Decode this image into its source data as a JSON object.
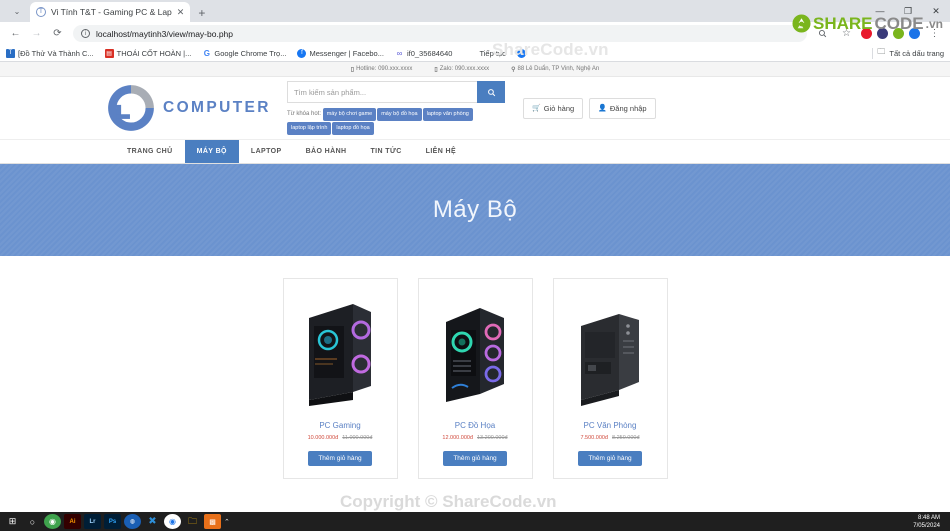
{
  "browser": {
    "tab": {
      "title": "Vi Tính T&T - Gaming PC & Lap",
      "favicon": "site-favicon",
      "close": "✕"
    },
    "new_tab": "+",
    "window_controls": {
      "minimize": "—",
      "maximize": "❐",
      "close": "✕"
    },
    "nav": {
      "back": "←",
      "forward": "→",
      "reload": "⟳"
    },
    "omnibox": {
      "url": "localhost/maytinh3/view/may-bo.php",
      "info_icon": "ⓘ",
      "zoom_icon": "🔍",
      "bookmark_icon": "☆"
    },
    "bookmarks": [
      {
        "label": "[Đồ Thử Và Thành C...",
        "color": "#2a6ec4",
        "glyph": "T"
      },
      {
        "label": "THOÁI CỐT HOÀN |...",
        "color": "#d93025",
        "glyph": "🗎"
      },
      {
        "label": "Google Chrome Trọ...",
        "color": "#ffffff",
        "glyph": "G"
      },
      {
        "label": "Messenger | Facebo...",
        "color": "#1877f2",
        "glyph": "f"
      },
      {
        "label": "if0_35684640",
        "color": "#ffffff",
        "glyph": "∞"
      },
      {
        "label": "Tiếp tục",
        "color": "#ffffff",
        "glyph": ""
      }
    ],
    "bookmarks_right": {
      "label": "Tất cả dấu trang",
      "icon": "folder-icon"
    }
  },
  "site": {
    "topbar": [
      {
        "icon": "phone-icon",
        "text": "Hotline: 090.xxx.xxxx"
      },
      {
        "icon": "phone-icon",
        "text": "Zalo: 090.xxx.xxxx"
      },
      {
        "icon": "location-icon",
        "text": "88 Lê Duẩn, TP Vinh, Nghệ An"
      }
    ],
    "logo": {
      "text": "COMPUTER",
      "mark": "tt-logo-mark"
    },
    "search": {
      "placeholder": "Tìm kiếm sản phẩm...",
      "value": "",
      "button_icon": "search-icon"
    },
    "keywords": {
      "label": "Từ khóa hot:",
      "tags": [
        "máy bộ chơi game",
        "máy bộ đồ họa",
        "laptop văn phòng",
        "laptop lập trình",
        "laptop đồ họa"
      ]
    },
    "header_buttons": [
      {
        "label": "Giỏ hàng",
        "icon": "cart-icon"
      },
      {
        "label": "Đăng nhập",
        "icon": "user-icon"
      }
    ],
    "nav": [
      {
        "label": "TRANG CHỦ",
        "active": false
      },
      {
        "label": "MÁY BỘ",
        "active": true
      },
      {
        "label": "LAPTOP",
        "active": false
      },
      {
        "label": "BẢO HÀNH",
        "active": false
      },
      {
        "label": "TIN TỨC",
        "active": false
      },
      {
        "label": "LIÊN HỆ",
        "active": false
      }
    ],
    "banner": {
      "title": "Máy Bộ"
    },
    "products": [
      {
        "name": "PC Gaming",
        "price_new": "10.000.000đ",
        "price_old": "11.000.000đ",
        "button": "Thêm giỏ hàng",
        "image": "pc-case-gaming-rgb"
      },
      {
        "name": "PC Đồ Họa",
        "price_new": "12.000.000đ",
        "price_old": "13.200.000đ",
        "button": "Thêm giỏ hàng",
        "image": "pc-case-graphics-rgb"
      },
      {
        "name": "PC Văn Phòng",
        "price_new": "7.500.000đ",
        "price_old": "8.250.000đ",
        "button": "Thêm giỏ hàng",
        "image": "pc-case-office"
      }
    ]
  },
  "watermarks": {
    "top_text": "ShareCode.vn",
    "bottom_text": "Copyright © ShareCode.vn",
    "logo": {
      "share": "SHARE",
      "code": "CODE",
      "vn": ".vn"
    }
  },
  "taskbar": {
    "icons": [
      {
        "name": "start-icon",
        "glyph": "⊞",
        "color": "#ffffff",
        "bg": "transparent"
      },
      {
        "name": "search-icon",
        "glyph": "○",
        "color": "#ffffff",
        "bg": "transparent"
      },
      {
        "name": "app-green-icon",
        "glyph": "◉",
        "color": "#ffffff",
        "bg": "#3fa34d"
      },
      {
        "name": "illustrator-icon",
        "glyph": "Ai",
        "color": "#ff9a00",
        "bg": "#330000"
      },
      {
        "name": "lightroom-icon",
        "glyph": "Lr",
        "color": "#9fd5ff",
        "bg": "#001e36"
      },
      {
        "name": "photoshop-icon",
        "glyph": "Ps",
        "color": "#31a8ff",
        "bg": "#001e36"
      },
      {
        "name": "media-icon",
        "glyph": "◍",
        "color": "#ffffff",
        "bg": "#1a5fb4"
      },
      {
        "name": "vscode-icon",
        "glyph": "✕",
        "color": "#2e8fd8",
        "bg": "transparent"
      },
      {
        "name": "chrome-icon",
        "glyph": "◉",
        "color": "#ffffff",
        "bg": "transparent"
      },
      {
        "name": "explorer-icon",
        "glyph": "🗀",
        "color": "#ffc107",
        "bg": "transparent"
      },
      {
        "name": "app-orange-icon",
        "glyph": "▩",
        "color": "#ffffff",
        "bg": "#e8701a"
      }
    ],
    "clock": {
      "time": "8:48 AM",
      "date": "7/05/2024"
    }
  }
}
